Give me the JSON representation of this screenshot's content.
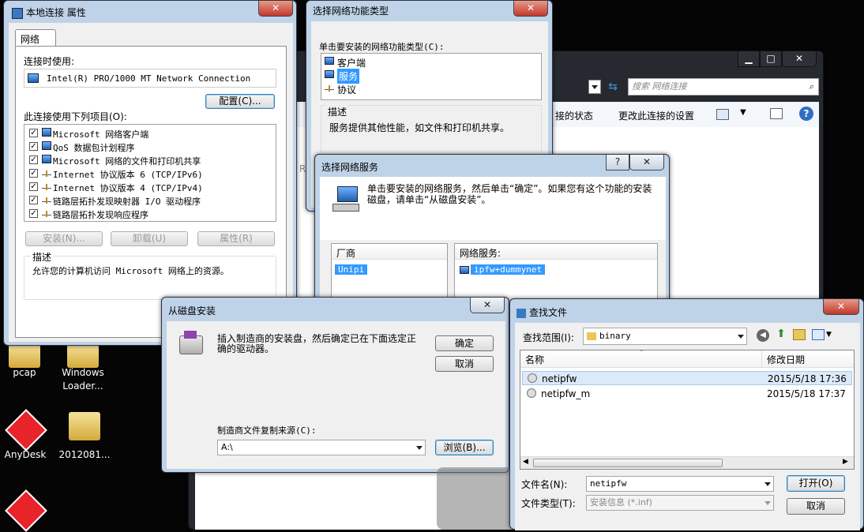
{
  "desktop": {
    "icons": [
      {
        "label": "pcap"
      },
      {
        "label": "Windows\nLoader..."
      },
      {
        "label": "AnyDesk"
      },
      {
        "label": "2012081..."
      }
    ]
  },
  "explorer": {
    "search_placeholder": "搜索 网络连接",
    "toolbar_status": "接的状态",
    "toolbar_change": "更改此连接的设置",
    "frag_ro": "RO",
    "help": "?"
  },
  "props": {
    "title": "本地连接 属性",
    "tab": "网络",
    "connect_using_label": "连接时使用:",
    "adapter": "Intel(R) PRO/1000 MT Network Connection",
    "configure_btn": "配置(C)...",
    "items_label": "此连接使用下列项目(O):",
    "items": [
      {
        "label": "Microsoft 网络客户端",
        "checked": true,
        "icon": "network-client-icon"
      },
      {
        "label": "QoS 数据包计划程序",
        "checked": true,
        "icon": "qos-icon"
      },
      {
        "label": "Microsoft 网络的文件和打印机共享",
        "checked": true,
        "icon": "share-icon"
      },
      {
        "label": "Internet 协议版本 6 (TCP/IPv6)",
        "checked": true,
        "icon": "protocol-icon"
      },
      {
        "label": "Internet 协议版本 4 (TCP/IPv4)",
        "checked": true,
        "icon": "protocol-icon"
      },
      {
        "label": "链路层拓扑发现映射器 I/O 驱动程序",
        "checked": true,
        "icon": "protocol-icon"
      },
      {
        "label": "链路层拓扑发现响应程序",
        "checked": true,
        "icon": "protocol-icon"
      }
    ],
    "install_btn": "安装(N)...",
    "uninstall_btn": "卸载(U)",
    "properties_btn": "属性(R)",
    "desc_label": "描述",
    "desc_text": "允许您的计算机访问 Microsoft 网络上的资源。",
    "close": "✕"
  },
  "feature": {
    "title": "选择网络功能类型",
    "prompt": "单击要安装的网络功能类型(C):",
    "items": [
      {
        "label": "客户端"
      },
      {
        "label": "服务",
        "selected": true
      },
      {
        "label": "协议"
      }
    ],
    "desc_label": "描述",
    "desc_text": "服务提供其他性能，如文件和打印机共享。",
    "close": "✕"
  },
  "service": {
    "title": "选择网络服务",
    "text": "单击要安装的网络服务，然后单击“确定”。如果您有这个功能的安装磁盘，请单击“从磁盘安装”。",
    "vendor_header": "厂商",
    "vendor_value": "Unipi",
    "service_header": "网络服务:",
    "service_value": "ipfw+dummynet",
    "help": "?",
    "close": "✕"
  },
  "disk": {
    "title": "从磁盘安装",
    "text": "插入制造商的安装盘，然后确定已在下面选定正确的驱动器。",
    "ok_btn": "确定",
    "cancel_btn": "取消",
    "copy_label": "制造商文件复制来源(C):",
    "copy_value": "A:\\",
    "browse_btn": "浏览(B)...",
    "close": "✕"
  },
  "find": {
    "title": "查找文件",
    "lookin_label": "查找范围(I):",
    "lookin_value": "binary",
    "col_name": "名称",
    "col_date": "修改日期",
    "files": [
      {
        "name": "netipfw",
        "date": "2015/5/18 17:36",
        "selected": true
      },
      {
        "name": "netipfw_m",
        "date": "2015/5/18 17:37",
        "selected": false
      }
    ],
    "filename_label": "文件名(N):",
    "filename_value": "netipfw",
    "filetype_label": "文件类型(T):",
    "filetype_value": "安装信息 (*.inf)",
    "open_btn": "打开(O)",
    "cancel_btn": "取消",
    "close": "✕"
  }
}
